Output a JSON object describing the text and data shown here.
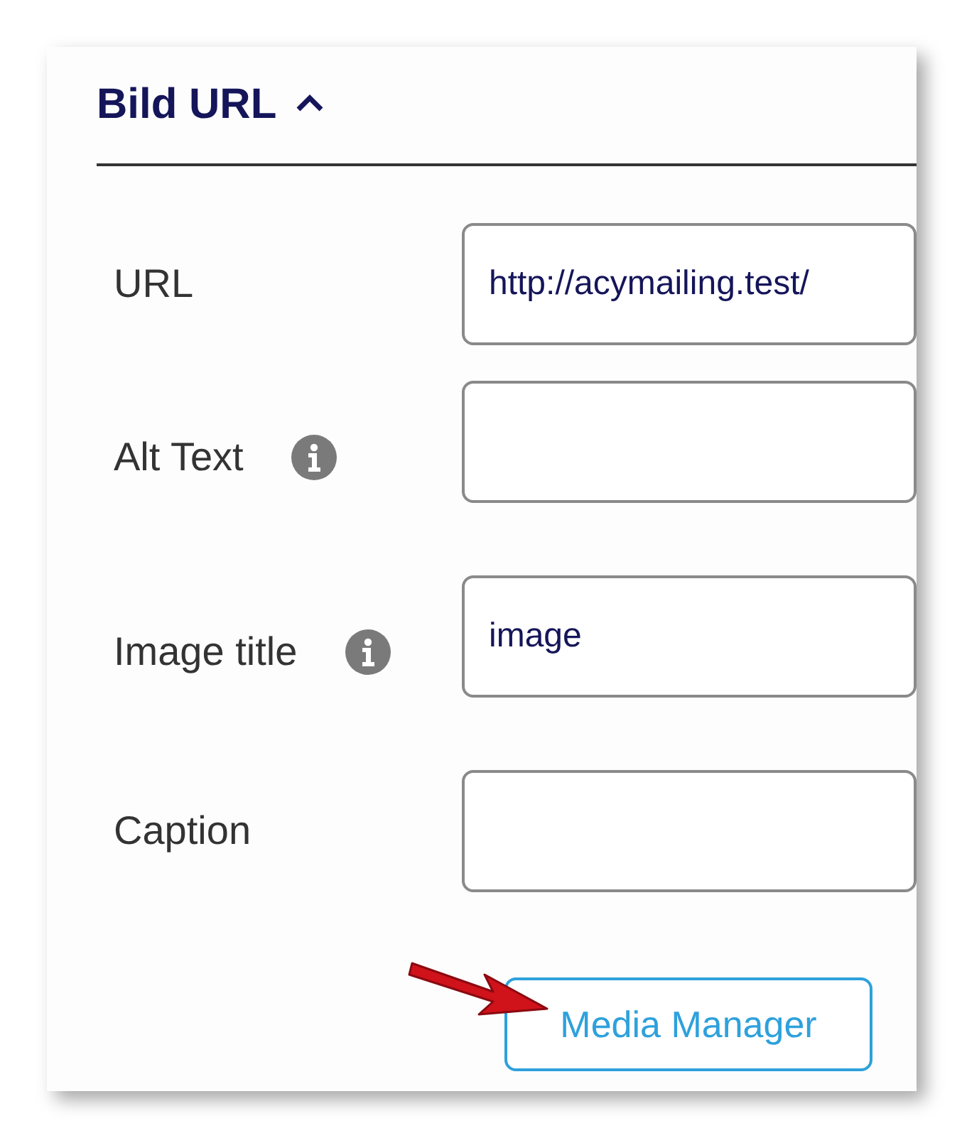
{
  "section": {
    "title": "Bild URL",
    "expanded": true
  },
  "fields": [
    {
      "label": "URL",
      "info": false,
      "value": "http://acymailing.test/"
    },
    {
      "label": "Alt Text",
      "info": true
    },
    {
      "label": "Image title",
      "info": true,
      "value": "image"
    },
    {
      "label": "Caption",
      "info": false
    }
  ],
  "buttons": [
    "Media Manager"
  ]
}
